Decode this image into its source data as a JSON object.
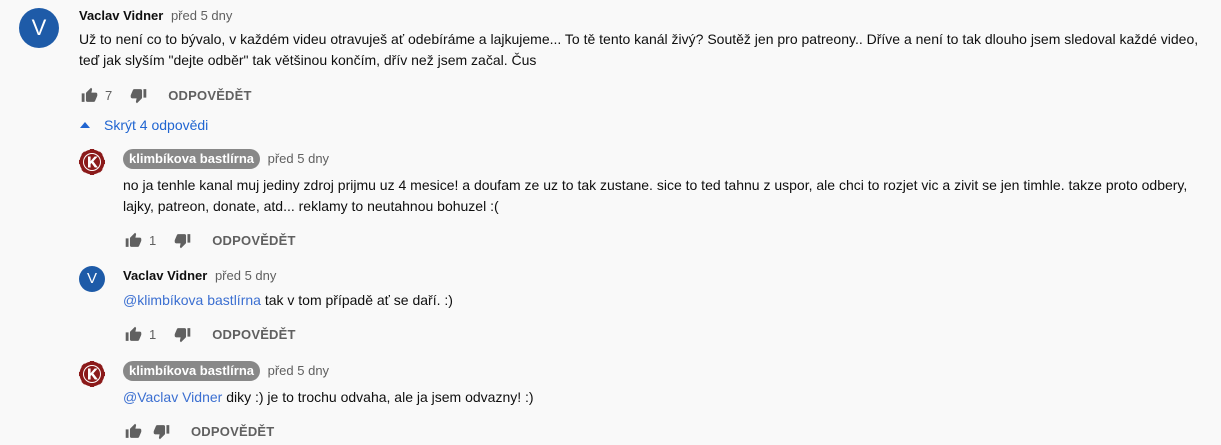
{
  "comments": [
    {
      "avatar_letter": "V",
      "author": "Vaclav Vidner",
      "time": "před 5 dny",
      "text": "Už to není co to bývalo, v každém videu otravuješ ať odebíráme a lajkujeme... To tě tento kanál živý? Soutěž jen pro patreony.. Dříve a není to tak dlouho jsem sledoval každé video, teď jak slyším \"dejte odběr\" tak většinou končím, dřív než jsem začal. Čus",
      "likes": "7",
      "reply_label": "ODPOVĚDĚT"
    }
  ],
  "toggle_replies_label": "Skrýt 4 odpovědi",
  "replies": [
    {
      "author": "klimbíkova bastlírna",
      "time": "před 5 dny",
      "text": "no ja tenhle kanal muj jediny zdroj prijmu uz 4 mesice! a doufam ze uz to tak zustane. sice to ted tahnu z uspor, ale chci to rozjet vic a zivit se jen timhle. takze proto odbery, lajky, patreon, donate, atd... reklamy to neutahnou bohuzel :(",
      "likes": "1",
      "reply_label": "ODPOVĚDĚT"
    },
    {
      "avatar_letter": "V",
      "author": "Vaclav Vidner",
      "time": "před 5 dny",
      "mention": "@klimbíkova bastlírna",
      "text": " tak v tom případě ať se daří. :)",
      "likes": "1",
      "reply_label": "ODPOVĚDĚT"
    },
    {
      "author": "klimbíkova bastlírna",
      "time": "před 5 dny",
      "mention": "@Vaclav Vidner",
      "text": " diky :) je to trochu odvaha, ale ja jsem odvazny! :)",
      "likes": "",
      "reply_label": "ODPOVĚDĚT"
    }
  ],
  "icons": {
    "like": "thumb-up-icon",
    "dislike": "thumb-down-icon",
    "toggle": "caret-up-icon",
    "channel_logo": "k-gear-logo"
  },
  "colors": {
    "avatar_blue": "#1e5ba8",
    "link_blue": "#2065d1",
    "badge_gray": "#888888",
    "logo_red": "#8b1a1a"
  }
}
